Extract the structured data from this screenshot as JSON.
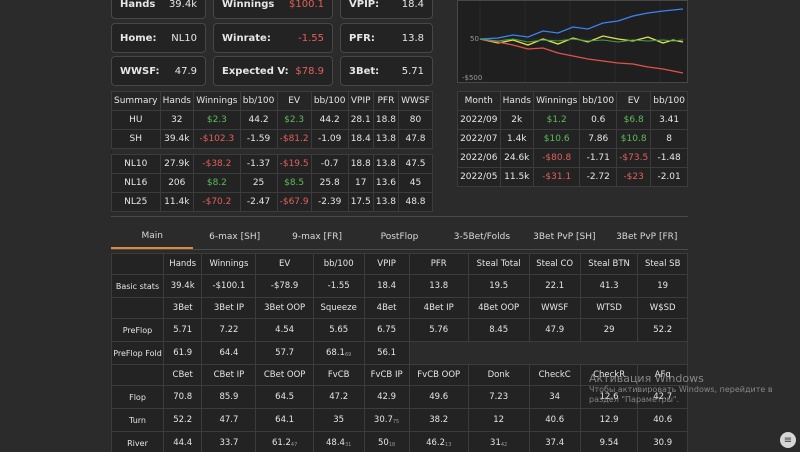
{
  "stat_boxes": [
    {
      "label": "Hands",
      "value": "39.4k",
      "neg": false
    },
    {
      "label": "Winnings",
      "value": "$100.1",
      "neg": true
    },
    {
      "label": "VPIP:",
      "value": "18.4",
      "neg": false
    },
    {
      "label": "Home:",
      "value": "NL10",
      "neg": false
    },
    {
      "label": "Winrate:",
      "value": "-1.55",
      "neg": true
    },
    {
      "label": "PFR:",
      "value": "13.8",
      "neg": false
    },
    {
      "label": "WWSF:",
      "value": "47.9",
      "neg": false
    },
    {
      "label": "Expected V:",
      "value": "$78.9",
      "neg": true
    },
    {
      "label": "3Bet:",
      "value": "5.71",
      "neg": false
    }
  ],
  "chart": {
    "tick_50": "50",
    "tick_neg500": "-$500",
    "colors": {
      "blue": "#3b82f6",
      "yellow": "#e6e04a",
      "red": "#e0524a",
      "green": "#3fa34d"
    }
  },
  "summary": {
    "headers": [
      "Summary",
      "Hands",
      "Winnings",
      "bb/100",
      "EV",
      "bb/100",
      "VPIP",
      "PFR",
      "WWSF"
    ],
    "rows": [
      [
        "HU",
        "32",
        "$2.3",
        "44.2",
        "$2.3",
        "44.2",
        "28.1",
        "18.8",
        "80"
      ],
      [
        "SH",
        "39.4k",
        "-$102.3",
        "-1.59",
        "-$81.2",
        "-1.09",
        "18.4",
        "13.8",
        "47.8"
      ],
      [
        "NL10",
        "27.9k",
        "-$38.2",
        "-1.37",
        "-$19.5",
        "-0.7",
        "18.8",
        "13.8",
        "47.5"
      ],
      [
        "NL16",
        "206",
        "$8.2",
        "25",
        "$8.5",
        "25.8",
        "17",
        "13.6",
        "45"
      ],
      [
        "NL25",
        "11.4k",
        "-$70.2",
        "-2.47",
        "-$67.9",
        "-2.39",
        "17.5",
        "13.8",
        "48.8"
      ]
    ]
  },
  "months": {
    "headers": [
      "Month",
      "Hands",
      "Winnings",
      "bb/100",
      "EV",
      "bb/100"
    ],
    "rows": [
      [
        "2022/09",
        "2k",
        "$1.2",
        "0.6",
        "$6.8",
        "3.41"
      ],
      [
        "2022/07",
        "1.4k",
        "$10.6",
        "7.86",
        "$10.8",
        "8"
      ],
      [
        "2022/06",
        "24.6k",
        "-$80.8",
        "-1.71",
        "-$73.5",
        "-1.48"
      ],
      [
        "2022/05",
        "11.5k",
        "-$31.1",
        "-2.72",
        "-$23",
        "-2.01"
      ]
    ]
  },
  "tabs": [
    "Main",
    "6-max [SH]",
    "9-max [FR]",
    "PostFlop",
    "3-5Bet/Folds",
    "3Bet PvP [SH]",
    "3Bet PvP [FR]"
  ],
  "main": {
    "hdr1": [
      "Hands",
      "Winnings",
      "EV",
      "bb/100",
      "VPIP",
      "PFR",
      "Steal Total",
      "Steal CO",
      "Steal BTN",
      "Steal SB"
    ],
    "basic": {
      "label": "Basic stats",
      "values": [
        "39.4k",
        "-$100.1",
        "-$78.9",
        "-1.55",
        "18.4",
        "13.8",
        "19.5",
        "22.1",
        "41.3",
        "19"
      ]
    },
    "hdr2": [
      "3Bet",
      "3Bet IP",
      "3Bet OOP",
      "Squeeze",
      "4Bet",
      "4Bet IP",
      "4Bet OOP",
      "WWSF",
      "WTSD",
      "W$SD"
    ],
    "preflop": {
      "label": "PreFlop",
      "values": [
        "5.71",
        "7.22",
        "4.54",
        "5.65",
        "6.75",
        "5.76",
        "8.45",
        "47.9",
        "29",
        "52.2"
      ]
    },
    "preflop_fold": {
      "label": "PreFlop Fold",
      "values": [
        "61.9",
        "64.4",
        "57.7",
        "68.1",
        "56.1"
      ],
      "sub4": "69"
    },
    "hdr3": [
      "CBet",
      "CBet IP",
      "CBet OOP",
      "FvCB",
      "FvCB IP",
      "FvCB OOP",
      "Donk",
      "CheckC",
      "CheckR",
      "AFq"
    ],
    "flop": {
      "label": "Flop",
      "values": [
        "70.8",
        "85.9",
        "64.5",
        "47.2",
        "42.9",
        "49.6",
        "7.23",
        "34",
        "12.6",
        "42.7"
      ]
    },
    "turn": {
      "label": "Turn",
      "values": [
        "52.2",
        "47.7",
        "64.1",
        "35",
        "30.7",
        "38.2",
        "12",
        "40.6",
        "12.9",
        "40.6"
      ],
      "sub5": "75"
    },
    "river": {
      "label": "River",
      "values": [
        "44.4",
        "33.7",
        "61.2",
        "48.4",
        "50",
        "46.2",
        "31",
        "37.4",
        "9.54",
        "30.9"
      ],
      "sub3": "47",
      "sub4": "31",
      "sub5": "18",
      "sub6": "13",
      "sub7": "42"
    }
  },
  "watermark": {
    "line1": "Активация Windows",
    "line2": "Чтобы активировать Windows, перейдите в",
    "line3": "раздел \"Параметры\"."
  },
  "scroll_icon": "≡"
}
